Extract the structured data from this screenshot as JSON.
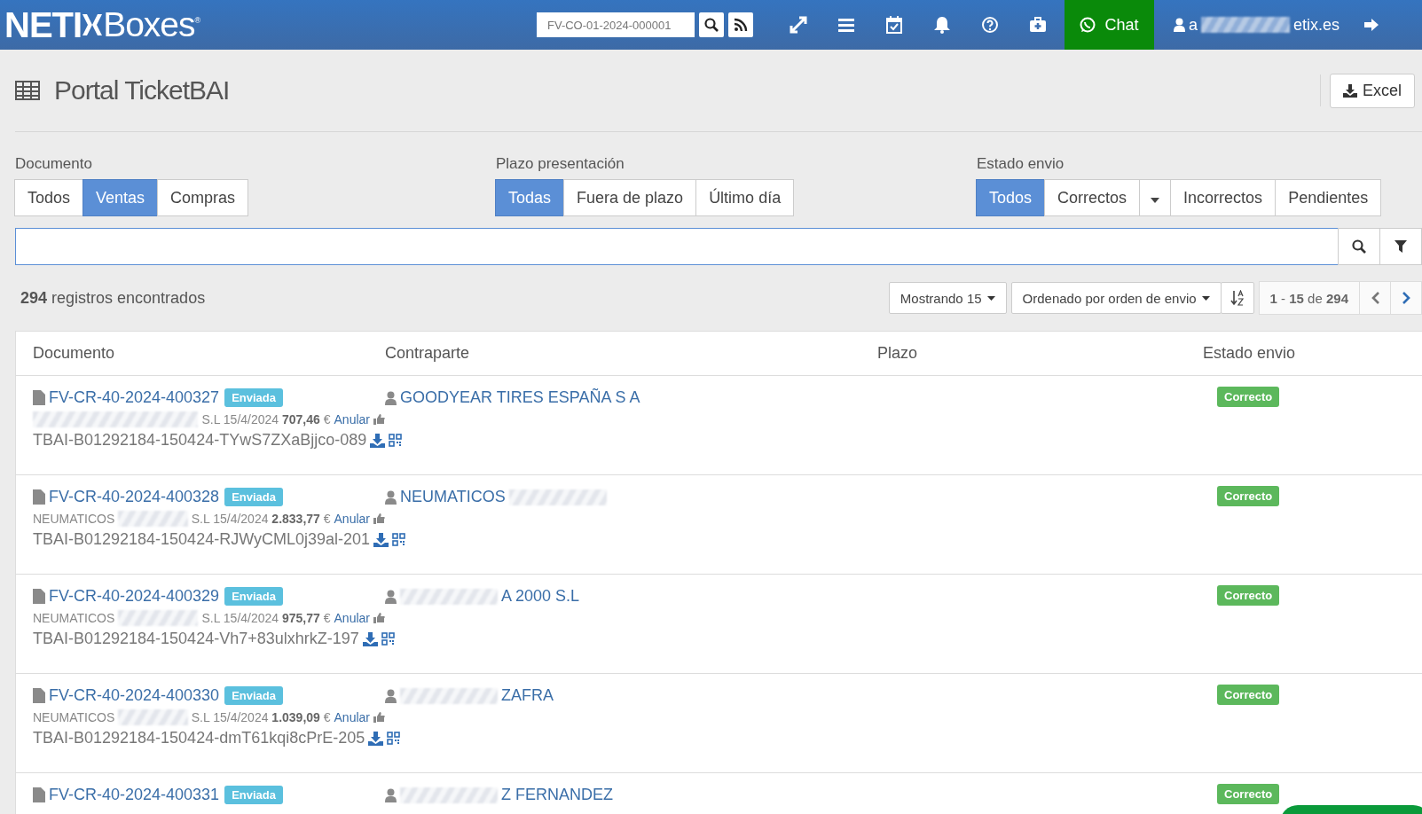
{
  "header": {
    "logo_left": "NETI",
    "logo_right": "Boxes",
    "logo_mark": "®",
    "quick_search": {
      "value": "FV-CO-01-2024-000001"
    },
    "chat": "Chat",
    "user": [
      {
        "kind": "text",
        "text": "a"
      },
      {
        "kind": "blurred"
      },
      {
        "kind": "text",
        "text": "etix.es"
      }
    ]
  },
  "page": {
    "title": "Portal TicketBAI",
    "export_button": "Excel"
  },
  "filters": [
    {
      "label": "Documento",
      "options": [
        {
          "kind": "option",
          "label": "Todos",
          "selected": false
        },
        {
          "kind": "option",
          "label": "Ventas",
          "selected": true
        },
        {
          "kind": "option",
          "label": "Compras",
          "selected": false
        }
      ]
    },
    {
      "label": "Plazo presentación",
      "options": [
        {
          "kind": "option",
          "label": "Todas",
          "selected": true
        },
        {
          "kind": "option",
          "label": "Fuera de plazo",
          "selected": false
        },
        {
          "kind": "option",
          "label": "Último día",
          "selected": false
        }
      ]
    },
    {
      "label": "Estado envio",
      "options": [
        {
          "kind": "option",
          "label": "Todos",
          "selected": true
        },
        {
          "kind": "option",
          "label": "Correctos",
          "selected": false
        },
        {
          "kind": "caret",
          "selected": false
        },
        {
          "kind": "option",
          "label": "Incorrectos",
          "selected": false
        },
        {
          "kind": "option",
          "label": "Pendientes",
          "selected": false
        }
      ]
    }
  ],
  "results": {
    "count": "**294** registros encontrados",
    "page_size": "Mostrando 15",
    "sort": "Ordenado por orden de envio",
    "range": "**1** - **15** de **294**"
  },
  "table": {
    "columns": [
      "Documento",
      "Contraparte",
      "Plazo",
      "Estado envio"
    ],
    "rows": [
      {
        "document": "FV-CR-40-2024-400327",
        "badge": "Enviada",
        "counterparty": [
          {
            "kind": "text",
            "text": "GOODYEAR TIRES ESPAÑA S A"
          }
        ],
        "issuer": [
          {
            "kind": "blurred"
          },
          {
            "kind": "text",
            "text": "S.L 15/4/2024 **707,46** €"
          }
        ],
        "action": "Anular",
        "code": "TBAI-B01292184-150424-TYwS7ZXaBjjco-089",
        "status": "Correcto"
      },
      {
        "document": "FV-CR-40-2024-400328",
        "badge": "Enviada",
        "counterparty": [
          {
            "kind": "text",
            "text": "NEUMATICOS"
          },
          {
            "kind": "blurred"
          }
        ],
        "issuer": [
          {
            "kind": "text",
            "text": "NEUMATICOS"
          },
          {
            "kind": "blurred"
          },
          {
            "kind": "text",
            "text": "S.L 15/4/2024 **2.833,77** €"
          }
        ],
        "action": "Anular",
        "code": "TBAI-B01292184-150424-RJWyCML0j39al-201",
        "status": "Correcto"
      },
      {
        "document": "FV-CR-40-2024-400329",
        "badge": "Enviada",
        "counterparty": [
          {
            "kind": "blurred"
          },
          {
            "kind": "text",
            "text": "A 2000 S.L"
          }
        ],
        "issuer": [
          {
            "kind": "text",
            "text": "NEUMATICOS"
          },
          {
            "kind": "blurred"
          },
          {
            "kind": "text",
            "text": "S.L 15/4/2024 **975,77** €"
          }
        ],
        "action": "Anular",
        "code": "TBAI-B01292184-150424-Vh7+83ulxhrkZ-197",
        "status": "Correcto"
      },
      {
        "document": "FV-CR-40-2024-400330",
        "badge": "Enviada",
        "counterparty": [
          {
            "kind": "blurred"
          },
          {
            "kind": "text",
            "text": "ZAFRA"
          }
        ],
        "issuer": [
          {
            "kind": "text",
            "text": "NEUMATICOS"
          },
          {
            "kind": "blurred"
          },
          {
            "kind": "text",
            "text": "S.L 15/4/2024 **1.039,09** €"
          }
        ],
        "action": "Anular",
        "code": "TBAI-B01292184-150424-dmT61kqi8cPrE-205",
        "status": "Correcto"
      },
      {
        "document": "FV-CR-40-2024-400331",
        "badge": "Enviada",
        "counterparty": [
          {
            "kind": "blurred"
          },
          {
            "kind": "text",
            "text": "Z FERNANDEZ"
          }
        ],
        "status": "Correcto"
      }
    ]
  }
}
